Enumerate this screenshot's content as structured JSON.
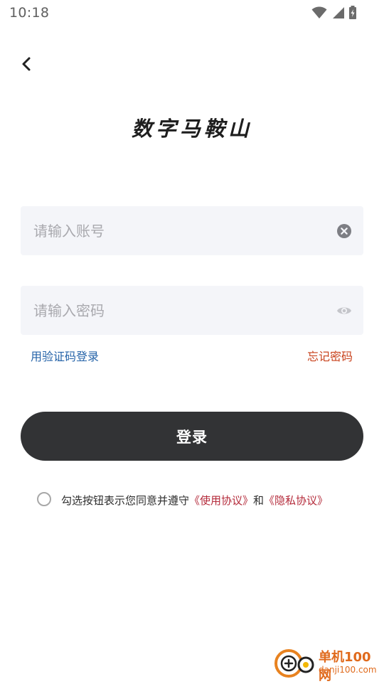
{
  "status_bar": {
    "time": "10:18",
    "icons": [
      "wifi-icon",
      "signal-icon",
      "battery-icon"
    ]
  },
  "header": {
    "back_icon": "chevron-left-icon",
    "app_title": "数字马鞍山"
  },
  "form": {
    "account": {
      "placeholder": "请输入账号",
      "value": "",
      "clear_icon": "clear-circle-icon"
    },
    "password": {
      "placeholder": "请输入密码",
      "value": "",
      "toggle_icon": "eye-icon"
    },
    "sms_login_label": "用验证码登录",
    "forgot_label": "忘记密码",
    "login_label": "登录"
  },
  "agreement": {
    "checked": false,
    "prefix": "勾选按钮表示您同意并遵守",
    "link1": "《使用协议》",
    "middle": "和",
    "link2": "《隐私协议》"
  },
  "watermark": {
    "title": "单机100网",
    "url": "danji100.com"
  },
  "colors": {
    "button_bg": "#323335",
    "field_bg": "#f4f5f9",
    "sms_link": "#2563a8",
    "forgot_link": "#c8411b",
    "agreement_link": "#b42a3a"
  }
}
